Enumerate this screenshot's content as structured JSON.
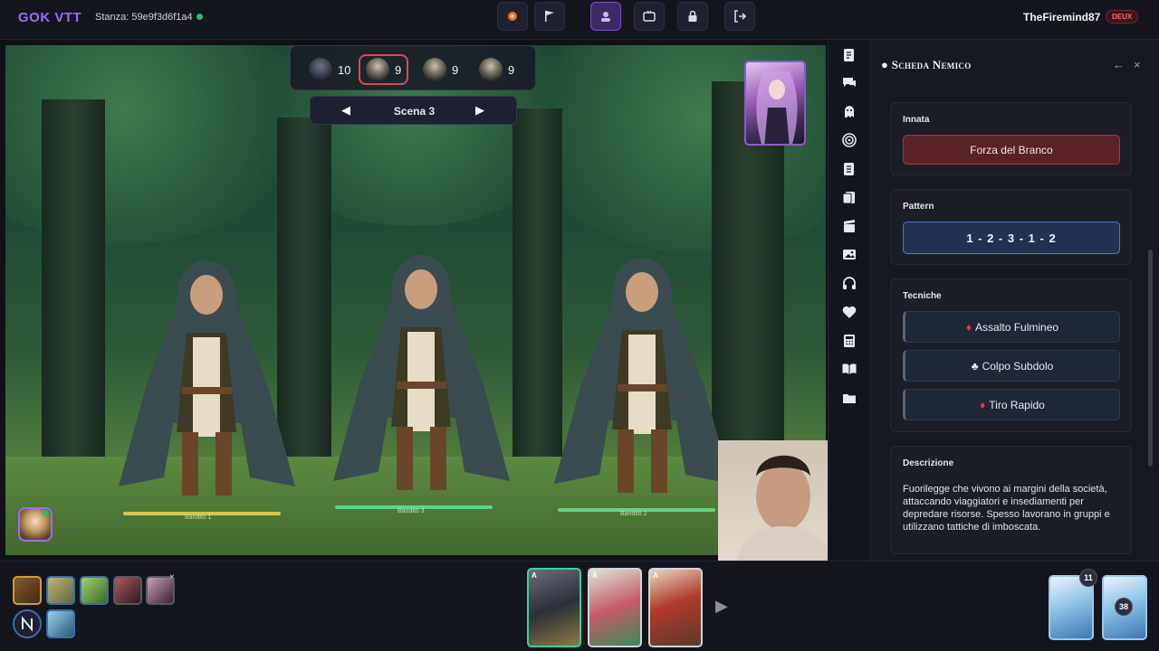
{
  "app": {
    "brand": "GOK VTT",
    "room_label": "Stanza: 59e9f3d6f1a4"
  },
  "user": {
    "name": "TheFiremind87",
    "badge": "DEUX"
  },
  "toolbar": {
    "buttons": [
      {
        "name": "combat-icon"
      },
      {
        "name": "flag-icon"
      },
      {
        "name": "gm-portrait-icon",
        "active": true
      },
      {
        "name": "screen-icon"
      },
      {
        "name": "lock-icon"
      },
      {
        "name": "exit-icon"
      }
    ]
  },
  "turn_order": [
    {
      "value": "10"
    },
    {
      "value": "9",
      "current": true
    },
    {
      "value": "9"
    },
    {
      "value": "9"
    }
  ],
  "scene": {
    "title": "Scena 3",
    "prev": "◀",
    "next": "▶"
  },
  "enemies": [
    {
      "label": "Bandito 1",
      "hp_fraction": 1.0,
      "hp_color": "yellow"
    },
    {
      "label": "Bandito 3",
      "hp_fraction": 1.0,
      "hp_color": "green"
    },
    {
      "label": "Bandito 2",
      "hp_fraction": 1.0,
      "hp_color": "green"
    }
  ],
  "sidebar_icons": [
    "notes-icon",
    "chat-icon",
    "ghost-icon",
    "target-icon",
    "document-icon",
    "cards-icon",
    "cinema-icon",
    "image-icon",
    "headphones-icon",
    "heart-icon",
    "calculator-icon",
    "book-icon",
    "folder-icon"
  ],
  "panel": {
    "title": "Scheda Nemico",
    "back": "←",
    "close": "×",
    "innate_label": "Innata",
    "innate_value": "Forza del Branco",
    "pattern_label": "Pattern",
    "pattern_value": "1 - 2 - 3 - 1 - 2",
    "techniques_label": "Tecniche",
    "techniques": [
      {
        "suit": "♦",
        "suit_color": "red",
        "name": "Assalto Fulmineo"
      },
      {
        "suit": "♣",
        "suit_color": "white",
        "name": "Colpo Subdolo"
      },
      {
        "suit": "♦",
        "suit_color": "red",
        "name": "Tiro Rapido"
      }
    ],
    "description_label": "Descrizione",
    "description": "Fuorilegge che vivono ai margini della società, attaccando viaggiatori e insediamenti per depredare risorse. Spesso lavorano in gruppi e utilizzano tattiche di imboscata."
  },
  "hand": [
    {
      "rank": "A",
      "selected": true
    },
    {
      "rank": "A",
      "selected": false
    },
    {
      "rank": "A",
      "selected": false
    }
  ],
  "decks": [
    {
      "count": "11"
    },
    {
      "count": "38"
    }
  ],
  "party_close": "×",
  "colors": {
    "accent": "#9b6bff",
    "danger": "#e2384b",
    "online": "#22c55e",
    "pattern": "#4f78c4"
  }
}
